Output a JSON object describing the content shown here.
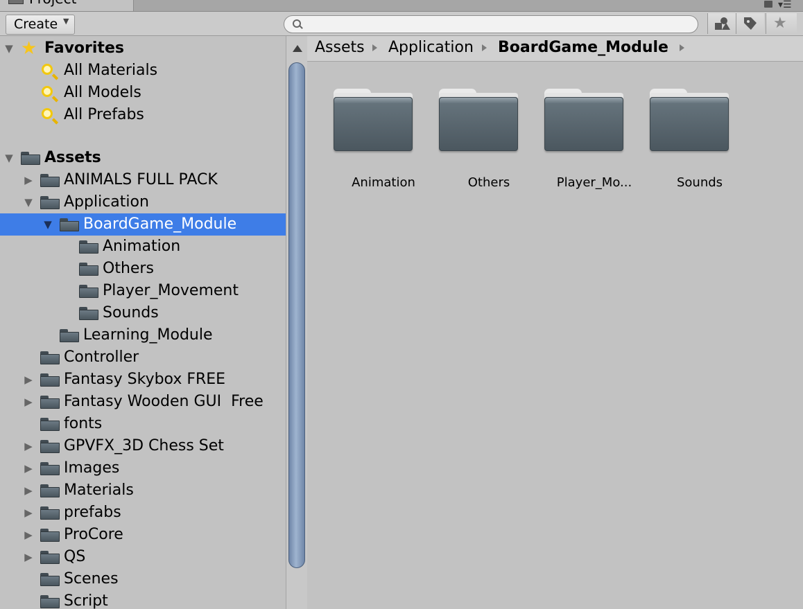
{
  "window": {
    "tab_title": "Project"
  },
  "toolbar": {
    "create_label": "Create",
    "search": {
      "value": "",
      "placeholder": ""
    }
  },
  "tree": {
    "favorites": {
      "title": "Favorites",
      "items": [
        {
          "label": "All Materials"
        },
        {
          "label": "All Models"
        },
        {
          "label": "All Prefabs"
        }
      ]
    },
    "assets": {
      "title": "Assets",
      "items": [
        {
          "label": "ANIMALS FULL PACK",
          "expander": "collapsed"
        },
        {
          "label": "Application",
          "expander": "expanded"
        },
        {
          "label": "BoardGame_Module",
          "expander": "expanded",
          "selected": true
        },
        {
          "label": "Animation"
        },
        {
          "label": "Others"
        },
        {
          "label": "Player_Movement"
        },
        {
          "label": "Sounds"
        },
        {
          "label": "Learning_Module"
        },
        {
          "label": "Controller"
        },
        {
          "label": "Fantasy Skybox FREE",
          "expander": "collapsed"
        },
        {
          "label": "Fantasy Wooden GUI  Free",
          "expander": "collapsed"
        },
        {
          "label": "fonts"
        },
        {
          "label": "GPVFX_3D Chess Set",
          "expander": "collapsed"
        },
        {
          "label": "Images",
          "expander": "collapsed"
        },
        {
          "label": "Materials",
          "expander": "collapsed"
        },
        {
          "label": "prefabs",
          "expander": "collapsed"
        },
        {
          "label": "ProCore",
          "expander": "collapsed"
        },
        {
          "label": "QS",
          "expander": "collapsed"
        },
        {
          "label": "Scenes"
        },
        {
          "label": "Script"
        }
      ]
    }
  },
  "breadcrumb": [
    "Assets",
    "Application",
    "BoardGame_Module"
  ],
  "grid": {
    "items": [
      {
        "label": "Animation"
      },
      {
        "label": "Others"
      },
      {
        "label": "Player_Mo..."
      },
      {
        "label": "Sounds"
      }
    ]
  },
  "colors": {
    "selection": "#3e7de7",
    "panel": "#c2c2c2",
    "folder": "#5a666e"
  }
}
